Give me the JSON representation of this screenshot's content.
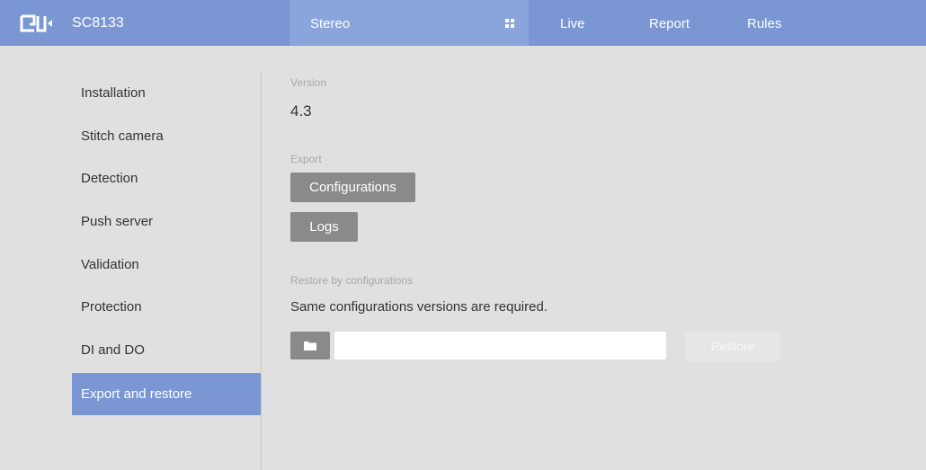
{
  "header": {
    "device_name": "SC8133",
    "tabs": [
      {
        "label": "Stereo",
        "active": true
      },
      {
        "label": "Live"
      },
      {
        "label": "Report"
      },
      {
        "label": "Rules"
      }
    ],
    "colors": {
      "bar": "#7a96d3",
      "active_tab": "#8aa5db"
    }
  },
  "sidebar": {
    "items": [
      {
        "label": "Installation"
      },
      {
        "label": "Stitch camera"
      },
      {
        "label": "Detection"
      },
      {
        "label": "Push server"
      },
      {
        "label": "Validation"
      },
      {
        "label": "Protection"
      },
      {
        "label": "DI and DO"
      },
      {
        "label": "Export and restore",
        "active": true
      }
    ]
  },
  "main": {
    "version": {
      "label": "Version",
      "value": "4.3"
    },
    "export": {
      "label": "Export",
      "configurations_button": "Configurations",
      "logs_button": "Logs"
    },
    "restore": {
      "label": "Restore by configurations",
      "note": "Same configurations versions are required.",
      "folder_icon": "folder-icon",
      "file_value": "",
      "restore_button": "Restore"
    }
  }
}
